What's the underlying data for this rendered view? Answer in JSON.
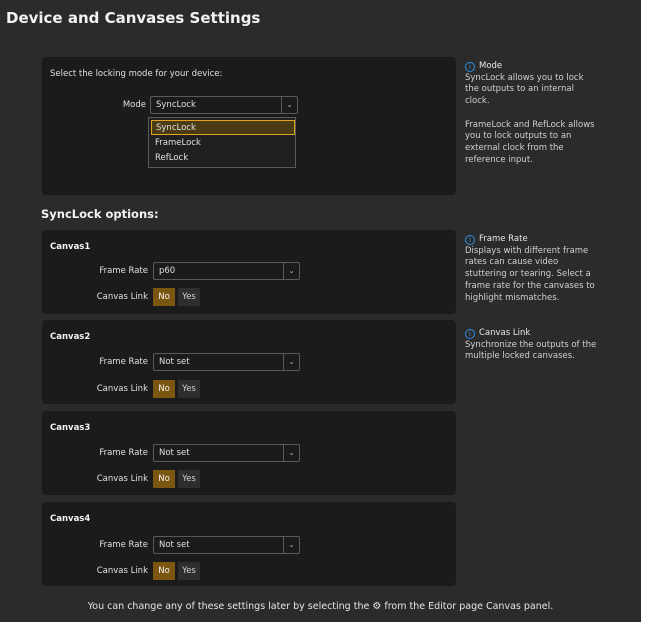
{
  "page": {
    "title": "Device and Canvases Settings"
  },
  "locking": {
    "instruction": "Select the locking mode for your device:",
    "mode_label": "Mode",
    "mode_value": "SyncLock",
    "options": [
      "SyncLock",
      "FrameLock",
      "RefLock"
    ],
    "selected_option": "SyncLock"
  },
  "synclock": {
    "section_title": "SyncLock options:",
    "canvases": [
      {
        "name": "Canvas1",
        "frame_rate_label": "Frame Rate",
        "frame_rate": "p60",
        "link_label": "Canvas Link",
        "link_no": "No",
        "link_yes": "Yes",
        "link_value": "No"
      },
      {
        "name": "Canvas2",
        "frame_rate_label": "Frame Rate",
        "frame_rate": "Not set",
        "link_label": "Canvas Link",
        "link_no": "No",
        "link_yes": "Yes",
        "link_value": "No"
      },
      {
        "name": "Canvas3",
        "frame_rate_label": "Frame Rate",
        "frame_rate": "Not set",
        "link_label": "Canvas Link",
        "link_no": "No",
        "link_yes": "Yes",
        "link_value": "No"
      },
      {
        "name": "Canvas4",
        "frame_rate_label": "Frame Rate",
        "frame_rate": "Not set",
        "link_label": "Canvas Link",
        "link_no": "No",
        "link_yes": "Yes",
        "link_value": "No"
      }
    ]
  },
  "help": {
    "mode": {
      "title": "Mode",
      "lines": [
        "SyncLock allows you to lock",
        "the outputs to an internal",
        "clock.",
        "",
        "FrameLock and RefLock allows",
        "you to lock outputs to an",
        "external clock from the",
        "reference input."
      ]
    },
    "frame_rate": {
      "title": "Frame Rate",
      "lines": [
        "Displays with different frame",
        "rates can cause video",
        "stuttering or tearing. Select a",
        "frame rate for the canvases to",
        "highlight mismatches."
      ]
    },
    "canvas_link": {
      "title": "Canvas Link",
      "lines": [
        "Synchronize the outputs of the",
        "multiple locked canvases."
      ]
    }
  },
  "footer": {
    "before": "You can change any of these settings later by selecting the",
    "after": "from the Editor page Canvas panel."
  },
  "colors": {
    "background": "#2b2b2b",
    "panel": "#1b1b1b",
    "accent": "#e0a326",
    "toggle_on": "#7a5610",
    "info": "#2f8fe0"
  }
}
